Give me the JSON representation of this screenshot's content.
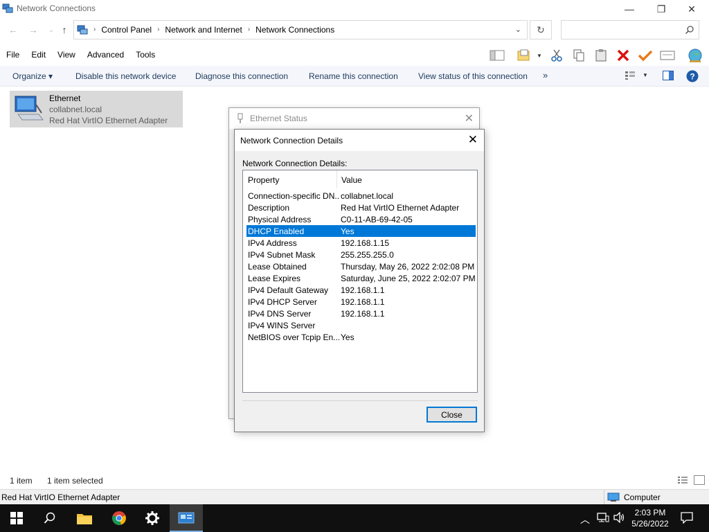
{
  "window": {
    "title": "Network Connections",
    "controls": {
      "minimize": "—",
      "maximize": "❐",
      "close": "✕"
    }
  },
  "address": {
    "breadcrumbs": [
      "Control Panel",
      "Network and Internet",
      "Network Connections"
    ],
    "search_placeholder": ""
  },
  "menu": [
    "File",
    "Edit",
    "View",
    "Advanced",
    "Tools"
  ],
  "commands": {
    "organize": "Organize ▾",
    "disable": "Disable this network device",
    "diagnose": "Diagnose this connection",
    "rename": "Rename this connection",
    "view_status": "View status of this connection",
    "more": "»"
  },
  "item": {
    "name": "Ethernet",
    "domain": "collabnet.local",
    "adapter": "Red Hat VirtIO Ethernet Adapter"
  },
  "status": {
    "count": "1 item",
    "selected": "1 item selected",
    "bottom_left": "Red Hat VirtIO Ethernet Adapter",
    "bottom_right": "Computer"
  },
  "status_dialog": {
    "title": "Ethernet Status"
  },
  "details_dialog": {
    "title": "Network Connection Details",
    "label": "Network Connection Details:",
    "columns": [
      "Property",
      "Value"
    ],
    "rows": [
      [
        "Connection-specific DN...",
        "collabnet.local"
      ],
      [
        "Description",
        "Red Hat VirtIO Ethernet Adapter"
      ],
      [
        "Physical Address",
        "C0-11-AB-69-42-05"
      ],
      [
        "DHCP Enabled",
        "Yes"
      ],
      [
        "IPv4 Address",
        "192.168.1.15"
      ],
      [
        "IPv4 Subnet Mask",
        "255.255.255.0"
      ],
      [
        "Lease Obtained",
        "Thursday, May 26, 2022 2:02:08 PM"
      ],
      [
        "Lease Expires",
        "Saturday, June 25, 2022 2:02:07 PM"
      ],
      [
        "IPv4 Default Gateway",
        "192.168.1.1"
      ],
      [
        "IPv4 DHCP Server",
        "192.168.1.1"
      ],
      [
        "IPv4 DNS Server",
        "192.168.1.1"
      ],
      [
        "IPv4 WINS Server",
        ""
      ],
      [
        "NetBIOS over Tcpip En...",
        "Yes"
      ]
    ],
    "selected_row": 3,
    "close_label": "Close"
  },
  "taskbar": {
    "time": "2:03 PM",
    "date": "5/26/2022"
  },
  "colors": {
    "accent": "#0078d7",
    "taskbar": "#101010",
    "command_text": "#1e3a5c"
  }
}
